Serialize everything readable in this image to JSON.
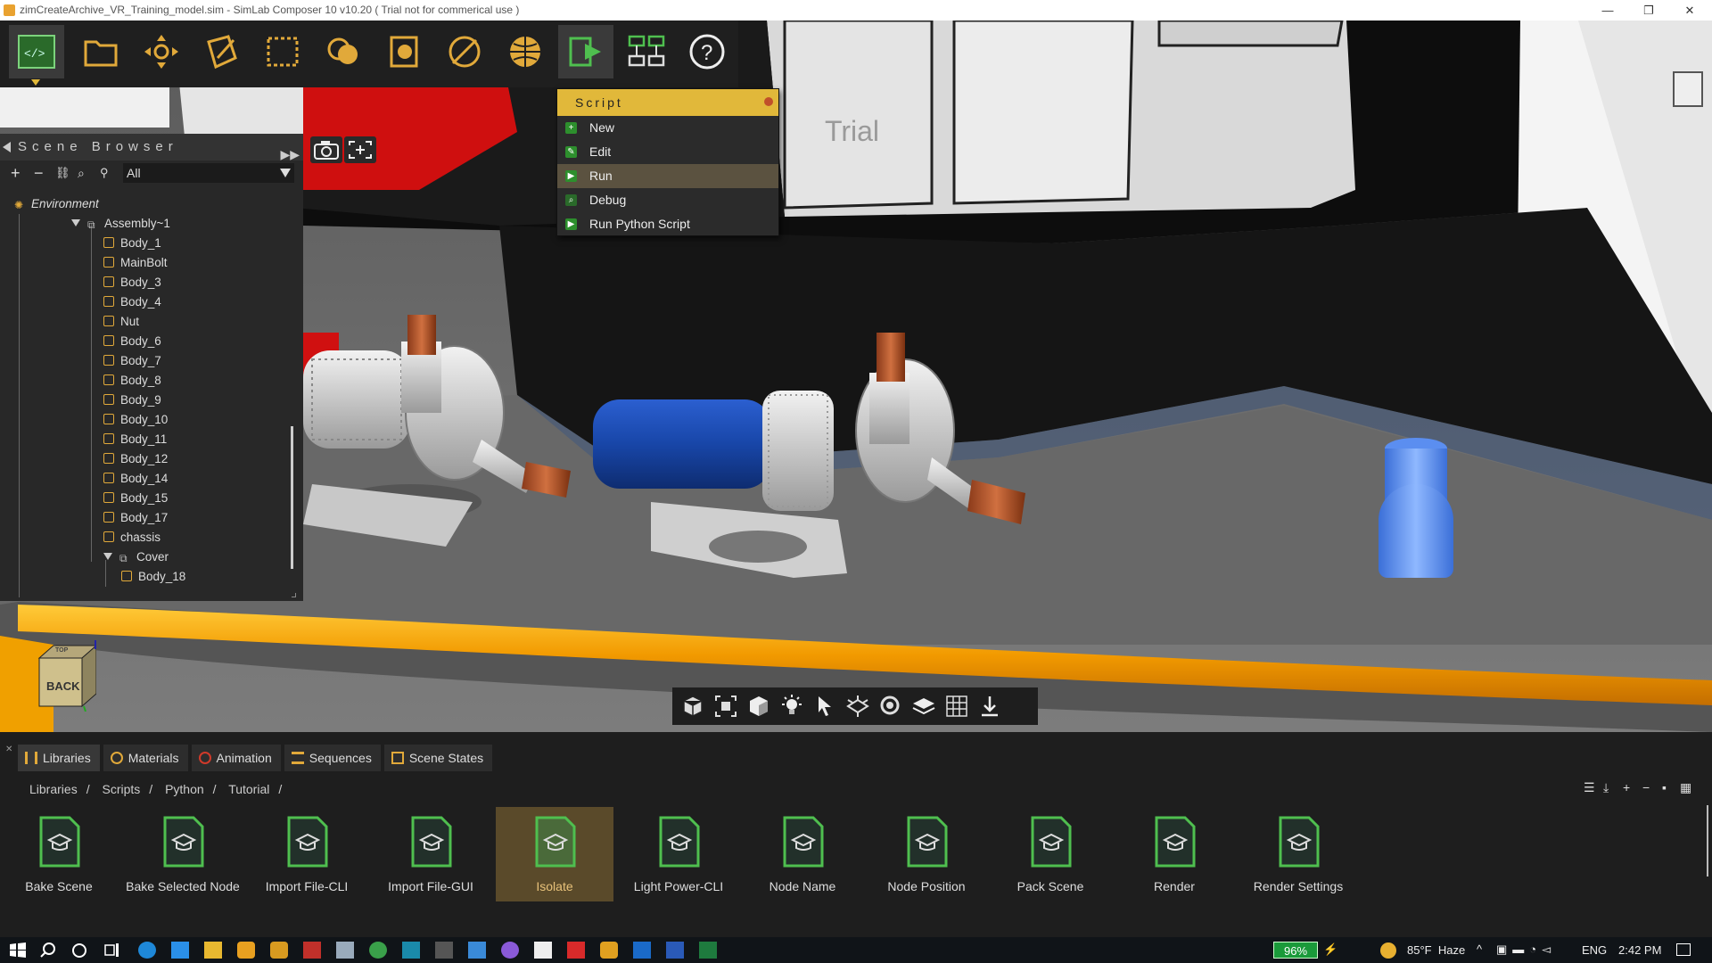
{
  "window": {
    "title": "zimCreateArchive_VR_Training_model.sim - SimLab Composer 10 v10.20 ( Trial not for commerical use )",
    "controls": [
      "—",
      "❐",
      "✕"
    ]
  },
  "viewport": {
    "watermark": "Trial",
    "view_cube_label": "BACK",
    "view_cube_top": "TOP"
  },
  "toolbar": {
    "items": [
      "script-editor",
      "file",
      "transform",
      "edit",
      "select",
      "materials",
      "render",
      "sections",
      "environment",
      "script",
      "automation",
      "help"
    ]
  },
  "script_menu": {
    "title": "Script",
    "items": [
      {
        "label": "New",
        "icon": "new-icon"
      },
      {
        "label": "Edit",
        "icon": "edit-icon"
      },
      {
        "label": "Run",
        "icon": "run-icon"
      },
      {
        "label": "Debug",
        "icon": "debug-icon"
      },
      {
        "label": "Run Python Script",
        "icon": "python-icon"
      }
    ],
    "highlighted": "Run"
  },
  "scene_browser": {
    "title": "Scene Browser",
    "filter": "All",
    "tree": [
      {
        "label": "Environment",
        "depth": 0,
        "type": "env"
      },
      {
        "label": "Assembly~1",
        "depth": 1,
        "type": "assembly"
      },
      {
        "label": "Body_1",
        "depth": 2,
        "type": "body"
      },
      {
        "label": "MainBolt",
        "depth": 2,
        "type": "body"
      },
      {
        "label": "Body_3",
        "depth": 2,
        "type": "body"
      },
      {
        "label": "Body_4",
        "depth": 2,
        "type": "body"
      },
      {
        "label": "Nut",
        "depth": 2,
        "type": "body"
      },
      {
        "label": "Body_6",
        "depth": 2,
        "type": "body"
      },
      {
        "label": "Body_7",
        "depth": 2,
        "type": "body"
      },
      {
        "label": "Body_8",
        "depth": 2,
        "type": "body"
      },
      {
        "label": "Body_9",
        "depth": 2,
        "type": "body"
      },
      {
        "label": "Body_10",
        "depth": 2,
        "type": "body"
      },
      {
        "label": "Body_11",
        "depth": 2,
        "type": "body"
      },
      {
        "label": "Body_12",
        "depth": 2,
        "type": "body"
      },
      {
        "label": "Body_14",
        "depth": 2,
        "type": "body"
      },
      {
        "label": "Body_15",
        "depth": 2,
        "type": "body"
      },
      {
        "label": "Body_17",
        "depth": 2,
        "type": "body"
      },
      {
        "label": "chassis",
        "depth": 2,
        "type": "body"
      },
      {
        "label": "Cover",
        "depth": 2,
        "type": "assembly"
      },
      {
        "label": "Body_18",
        "depth": 3,
        "type": "body"
      }
    ]
  },
  "tabs": [
    {
      "label": "Libraries",
      "active": true
    },
    {
      "label": "Materials",
      "active": false
    },
    {
      "label": "Animation",
      "active": false
    },
    {
      "label": "Sequences",
      "active": false
    },
    {
      "label": "Scene States",
      "active": false
    }
  ],
  "breadcrumb": [
    "Libraries",
    "/",
    "Scripts",
    "/",
    "Python",
    "/",
    "Tutorial",
    "/"
  ],
  "library_items": [
    {
      "label": "Bake Scene",
      "selected": false
    },
    {
      "label": "Bake Selected Node",
      "selected": false
    },
    {
      "label": "Import File-CLI",
      "selected": false
    },
    {
      "label": "Import File-GUI",
      "selected": false
    },
    {
      "label": "Isolate",
      "selected": true
    },
    {
      "label": "Light Power-CLI",
      "selected": false
    },
    {
      "label": "Node Name",
      "selected": false
    },
    {
      "label": "Node Position",
      "selected": false
    },
    {
      "label": "Pack Scene",
      "selected": false
    },
    {
      "label": "Render",
      "selected": false
    },
    {
      "label": "Render Settings",
      "selected": false
    }
  ],
  "taskbar": {
    "battery": "96%",
    "weather": "85°F  Haze",
    "language": "ENG",
    "time": "2:42 PM"
  },
  "colors": {
    "accent": "#e1b83a",
    "panel": "#282828",
    "selected_library": "#5a4a2a",
    "script_green": "#2d8f2d"
  }
}
